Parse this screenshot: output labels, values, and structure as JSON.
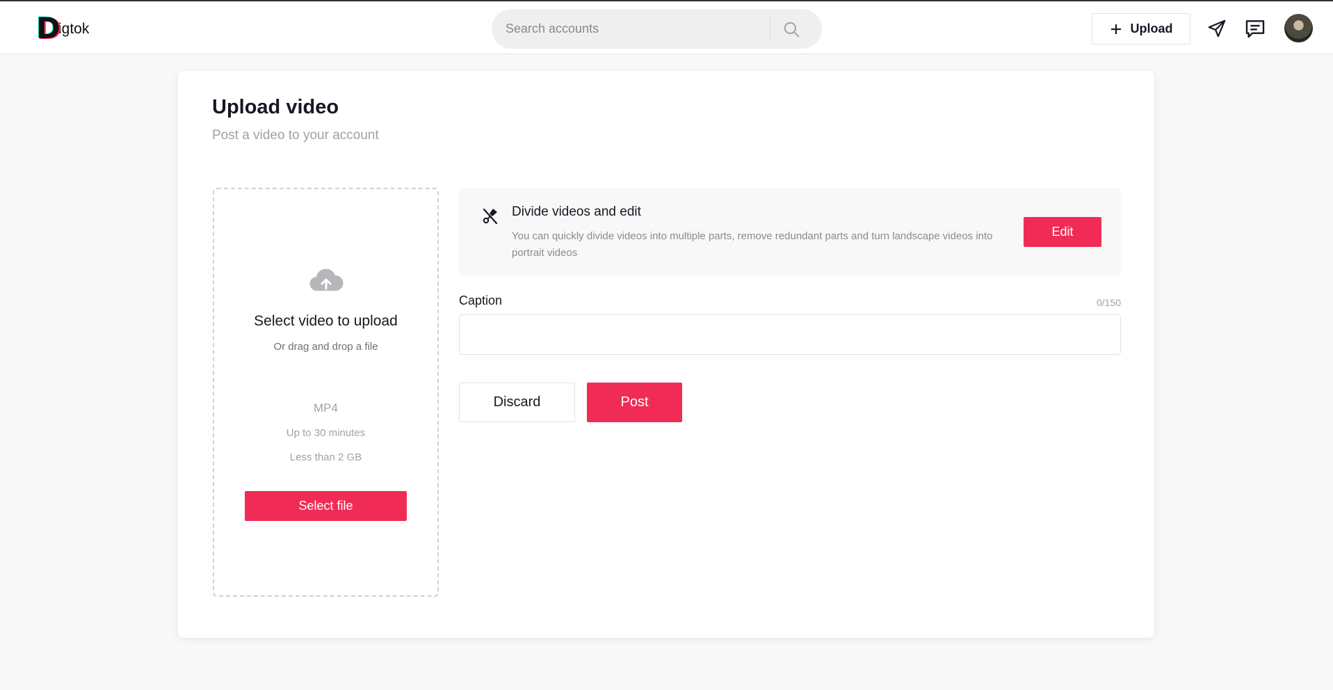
{
  "header": {
    "logo_text": "igtok",
    "logo_letter": "D",
    "search_placeholder": "Search accounts",
    "upload_label": "Upload",
    "icons": [
      "plus-icon",
      "send-icon",
      "message-icon",
      "search-icon"
    ]
  },
  "page": {
    "title": "Upload video",
    "subtitle": "Post a video to your account"
  },
  "dropzone": {
    "main_text": "Select video to upload",
    "sub_text": "Or drag and drop a file",
    "format": "MP4",
    "duration": "Up to 30 minutes",
    "size": "Less than 2 GB",
    "button_label": "Select file",
    "icon": "cloud-upload-icon"
  },
  "edit_panel": {
    "title": "Divide videos and edit",
    "description": "You can quickly divide videos into multiple parts, remove redundant parts and turn landscape videos into portrait videos",
    "button_label": "Edit",
    "icon": "scissors-icon"
  },
  "caption": {
    "label": "Caption",
    "counter": "0/150",
    "value": ""
  },
  "actions": {
    "discard_label": "Discard",
    "post_label": "Post"
  },
  "colors": {
    "accent": "#f02c56",
    "brand_cyan": "#25f4ee",
    "brand_pink": "#fe2c55"
  }
}
